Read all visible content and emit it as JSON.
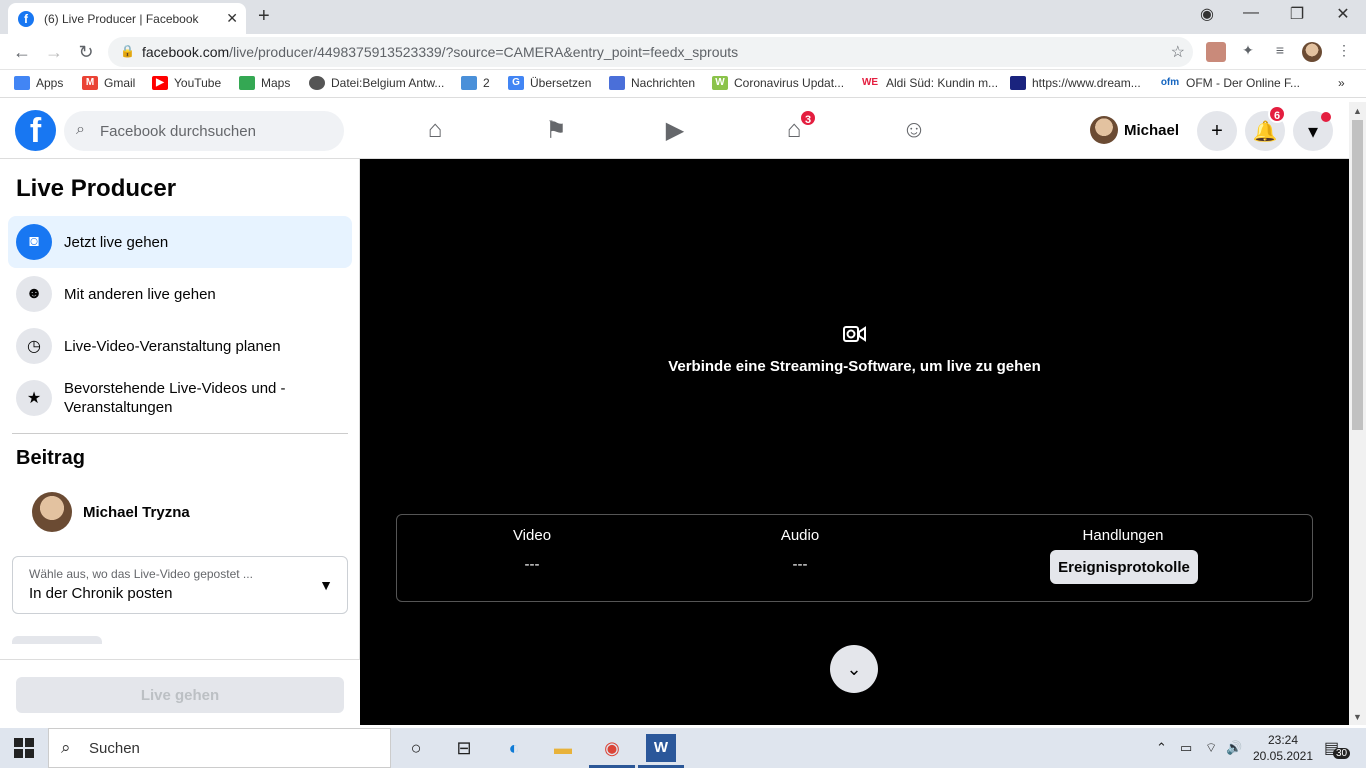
{
  "browser": {
    "tab_title": "(6) Live Producer | Facebook",
    "url_domain": "facebook.com",
    "url_path": "/live/producer/4498375913523339/?source=CAMERA&entry_point=feedx_sprouts",
    "bookmarks": [
      {
        "label": "Apps",
        "color": "#4285f4"
      },
      {
        "label": "Gmail",
        "color": "#ea4335"
      },
      {
        "label": "YouTube",
        "color": "#ff0000"
      },
      {
        "label": "Maps",
        "color": "#34a853"
      },
      {
        "label": "Datei:Belgium Antw...",
        "color": "#555555"
      },
      {
        "label": "2",
        "color": "#4a90d9"
      },
      {
        "label": "Übersetzen",
        "color": "#4285f4"
      },
      {
        "label": "Nachrichten",
        "color": "#4a6fd9"
      },
      {
        "label": "Coronavirus Updat...",
        "color": "#8bc34a"
      },
      {
        "label": "Aldi Süd: Kundin m...",
        "color": "#e41e3f"
      },
      {
        "label": "https://www.dream...",
        "color": "#1a237e"
      },
      {
        "label": "OFM - Der Online F...",
        "color": "#1565c0"
      }
    ]
  },
  "fb": {
    "search_placeholder": "Facebook durchsuchen",
    "marketplace_badge": "3",
    "notification_badge": "6",
    "user_name": "Michael"
  },
  "sidebar": {
    "title": "Live Producer",
    "items": [
      {
        "label": "Jetzt live gehen"
      },
      {
        "label": "Mit anderen live gehen"
      },
      {
        "label": "Live-Video-Veranstaltung planen"
      },
      {
        "label": "Bevorstehende Live-Videos und -Veranstaltungen"
      }
    ],
    "post_heading": "Beitrag",
    "poster_name": "Michael Tryzna",
    "select_label": "Wähle aus, wo das Live-Video gepostet ...",
    "select_value": "In der Chronik posten",
    "go_live_label": "Live gehen"
  },
  "main": {
    "connect_text": "Verbinde eine Streaming-Software, um live zu gehen",
    "video_label": "Video",
    "video_value": "---",
    "audio_label": "Audio",
    "audio_value": "---",
    "actions_label": "Handlungen",
    "event_log_button": "Ereignisprotokolle"
  },
  "taskbar": {
    "search_placeholder": "Suchen",
    "time": "23:24",
    "date": "20.05.2021",
    "notification_count": "30"
  }
}
